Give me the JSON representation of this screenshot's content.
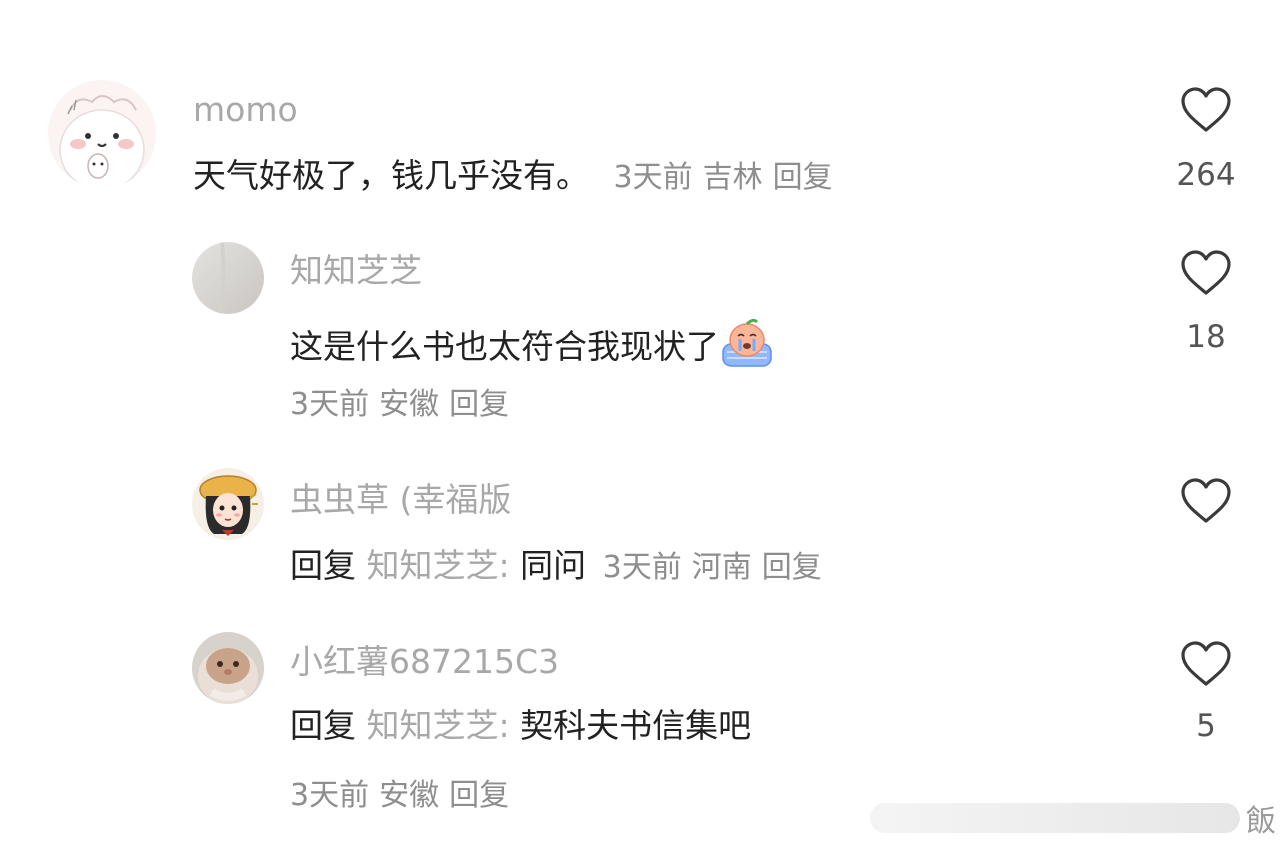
{
  "comments": [
    {
      "username": "momo",
      "text": "天气好极了，钱几乎没有。",
      "time": "3天前",
      "location": "吉林",
      "reply_label": "回复",
      "likes": "264",
      "avatar": "bunny-avatar"
    },
    {
      "username": "知知芝芝",
      "text": "这是什么书也太符合我现状了",
      "emoji": "crying-peach-emoji",
      "time": "3天前",
      "location": "安徽",
      "reply_label": "回复",
      "likes": "18",
      "avatar": "gray-avatar"
    },
    {
      "username": "虫虫草 (幸福版",
      "reply_prefix": "回复",
      "reply_target": "知知芝芝:",
      "text": "同问",
      "time": "3天前",
      "location": "河南",
      "reply_label": "回复",
      "likes": "",
      "avatar": "anime-girl-avatar"
    },
    {
      "username": "小红薯687215C3",
      "reply_prefix": "回复",
      "reply_target": "知知芝芝:",
      "text": "契科夫书信集吧",
      "time": "3天前",
      "location": "安徽",
      "reply_label": "回复",
      "likes": "5",
      "avatar": "cat-avatar"
    }
  ],
  "icons": {
    "like": "heart-outline-icon"
  },
  "colors": {
    "text": "#222222",
    "muted": "#8e8e8e",
    "username": "#a8a8a8"
  },
  "watermark": {
    "char": "飯"
  }
}
